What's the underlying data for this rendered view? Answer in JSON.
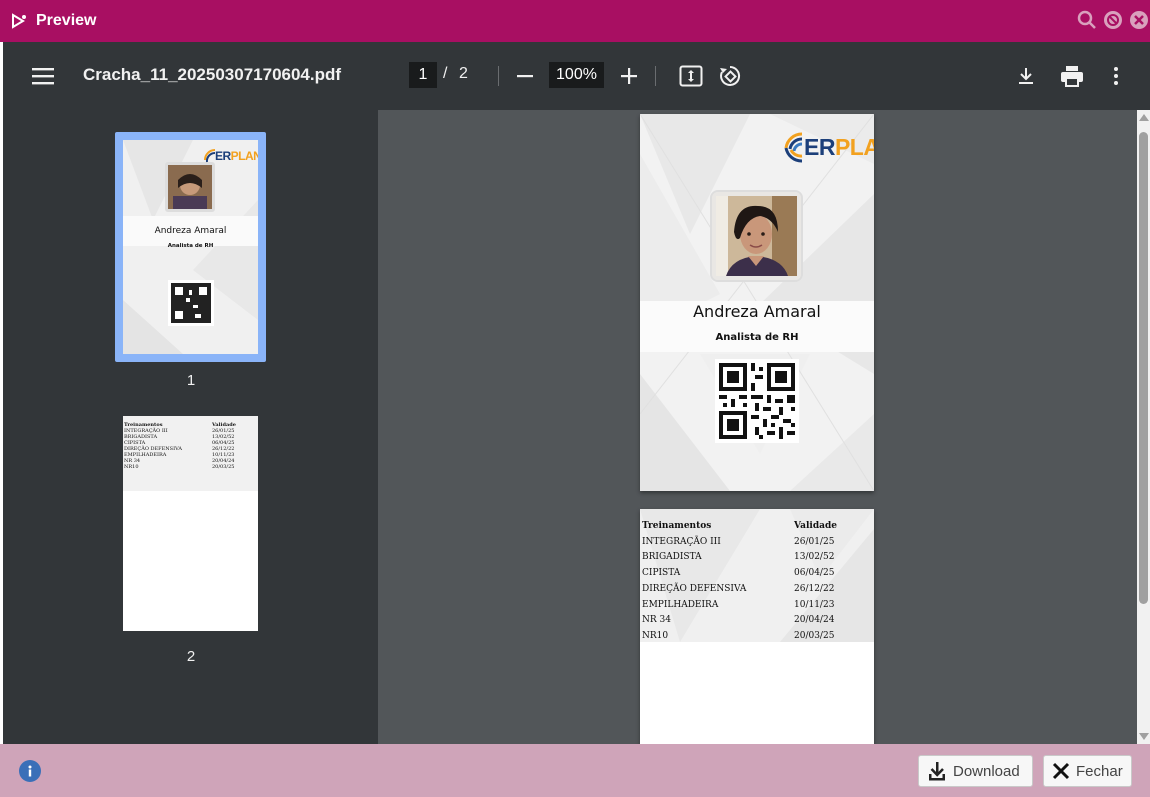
{
  "window": {
    "title": "Preview",
    "controls": [
      "search-icon",
      "minimize-icon",
      "close-icon"
    ]
  },
  "toolbar": {
    "filename": "Cracha_11_20250307170604.pdf",
    "current_page": "1",
    "page_separator": "/",
    "total_pages": "2",
    "zoom": "100%"
  },
  "thumbnails": [
    {
      "label": "1"
    },
    {
      "label": "2"
    }
  ],
  "badge": {
    "logo_er": "ER",
    "logo_plan": "PLAN",
    "name": "Andreza Amaral",
    "role": "Analista de RH"
  },
  "trainings": {
    "header": [
      "Treinamentos",
      "Validade"
    ],
    "rows": [
      [
        "INTEGRAÇÃO III",
        "26/01/25"
      ],
      [
        "BRIGADISTA",
        "13/02/52"
      ],
      [
        "CIPISTA",
        "06/04/25"
      ],
      [
        "DIREÇÃO DEFENSIVA",
        "26/12/22"
      ],
      [
        "EMPILHADEIRA",
        "10/11/23"
      ],
      [
        "NR 34",
        "20/04/24"
      ],
      [
        "NR10",
        "20/03/25"
      ]
    ]
  },
  "footer": {
    "download_label": "Download",
    "close_label": "Fechar"
  },
  "colors": {
    "titlebar": "#a80f62",
    "footer": "#cfa4b9",
    "pdf_toolbar": "#323639",
    "viewer_bg": "#525659",
    "thumb_highlight": "#8ab4f8",
    "logo_blue": "#1c3f7a",
    "logo_orange": "#f2a11f"
  }
}
